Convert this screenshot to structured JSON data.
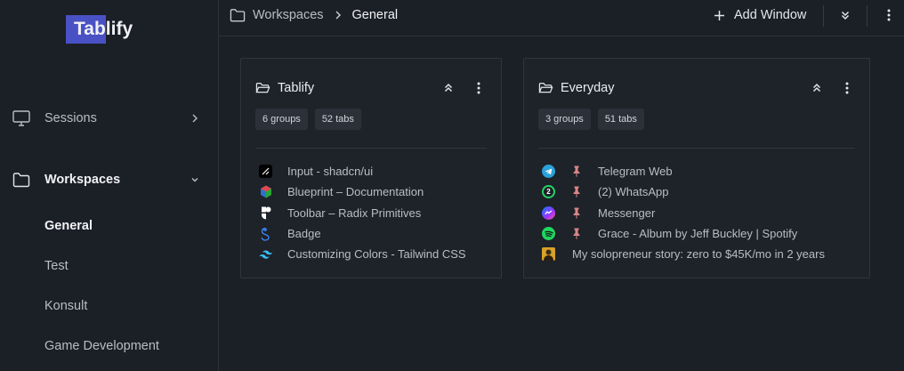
{
  "app": {
    "logo_highlight": "Tab",
    "logo_rest": "lify",
    "accent": "#4951c4"
  },
  "sidebar": {
    "items": [
      {
        "label": "Sessions",
        "icon": "monitor-icon",
        "expanded": false
      },
      {
        "label": "Workspaces",
        "icon": "folder-icon",
        "expanded": true
      }
    ],
    "workspaces": [
      "General",
      "Test",
      "Konsult",
      "Game Development"
    ],
    "active_workspace": "General"
  },
  "topbar": {
    "breadcrumb": [
      "Workspaces",
      "General"
    ],
    "add_window_label": "Add Window"
  },
  "cards": [
    {
      "title": "Tablify",
      "groups_badge": "6 groups",
      "tabs_badge": "52 tabs",
      "tabs": [
        {
          "title": "Input - shadcn/ui",
          "icon": "shadcn-icon",
          "pinned": false
        },
        {
          "title": "Blueprint – Documentation",
          "icon": "blueprint-icon",
          "pinned": false
        },
        {
          "title": "Toolbar – Radix Primitives",
          "icon": "radix-icon",
          "pinned": false
        },
        {
          "title": "Badge",
          "icon": "badge-site-icon",
          "pinned": false
        },
        {
          "title": "Customizing Colors - Tailwind CSS",
          "icon": "tailwind-icon",
          "pinned": false
        }
      ]
    },
    {
      "title": "Everyday",
      "groups_badge": "3 groups",
      "tabs_badge": "51 tabs",
      "tabs": [
        {
          "title": "Telegram Web",
          "icon": "telegram-icon",
          "pinned": true
        },
        {
          "title": "(2) WhatsApp",
          "icon": "whatsapp-icon",
          "pinned": true,
          "favicon_badge": "2"
        },
        {
          "title": "Messenger",
          "icon": "messenger-icon",
          "pinned": true
        },
        {
          "title": "Grace - Album by Jeff Buckley | Spotify",
          "icon": "spotify-icon",
          "pinned": true
        },
        {
          "title": "My solopreneur story: zero to $45K/mo in 2 years",
          "icon": "avatar-thumbnail-icon",
          "pinned": false
        }
      ]
    }
  ]
}
